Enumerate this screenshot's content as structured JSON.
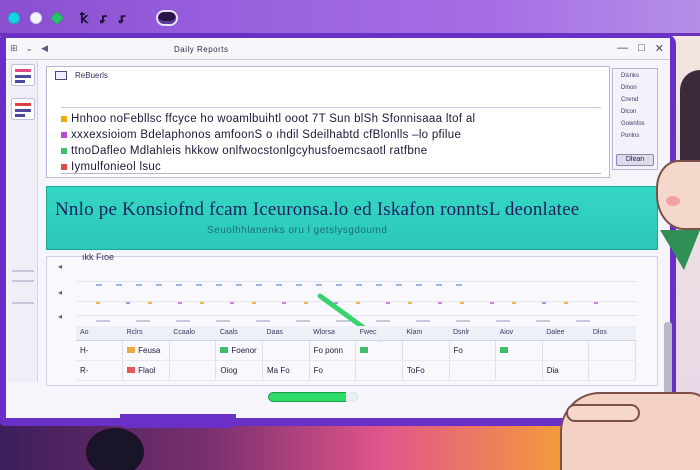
{
  "top_bar": {
    "glyphs": [
      "ꝁ",
      "ꭉ",
      "ꭉ"
    ]
  },
  "window": {
    "title": "Daily Reports",
    "controls": [
      "—",
      "□",
      "✕"
    ]
  },
  "document": {
    "header_label": "ReBuerls",
    "lines": [
      "Hnhoo noFebllsc ffcyce ho woamlbuihtl ooot 7T Sun blSh Sfonnisaaa ltof al",
      "xxxexsioiom Bdelaphonos amfoonS  o ıhdil Sdeilhabtd cfBlonlls –lo pfilue",
      "ttnoDafleo Mdlahleis hkkow onlfwocstonlgcyhusfoemcsaotl ratfbne",
      "Iymulfonieol lsuc"
    ]
  },
  "properties": {
    "items": [
      "Disnks",
      "Dlnon",
      "Cnvnd",
      "Dlcon",
      "Gownfos",
      "Ponlns"
    ],
    "button": "Dlɐan"
  },
  "banner": {
    "title": "Nnlo pe Konsiofnd fcam Iceuronsa.lo ed Iskafon ronntsL deonlatee",
    "subtitle": "Seuolhhlanenks oru l getslysgdoumd"
  },
  "panel": {
    "label": "ıkk Fıoe",
    "columns": [
      "Ao",
      "Rclrs",
      "Ccaalo",
      "Caals",
      "Daas",
      "Wlorsa",
      "Fwec",
      "Klam",
      "Dsnlr",
      "Aiov",
      "Dalee",
      "Dlos"
    ],
    "rows": [
      [
        "H-",
        "Feusa",
        "",
        "Foenor",
        "",
        "Fo ponn",
        "",
        "",
        "Fo",
        "",
        "",
        ""
      ],
      [
        "R-",
        "Flaol",
        "",
        "Oiog",
        "Ma Fo",
        "Fo",
        "",
        "ToFo",
        "",
        "",
        "Dia",
        ""
      ]
    ]
  },
  "colors": {
    "frame": "#6a2fc6",
    "banner": "#34d8c4",
    "accent_green": "#2edc6a",
    "bg_gradient_end": "#f6c15b"
  }
}
